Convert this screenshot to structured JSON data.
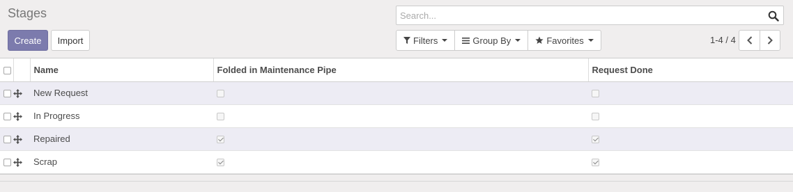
{
  "page": {
    "title": "Stages"
  },
  "buttons": {
    "create": "Create",
    "import": "Import"
  },
  "search": {
    "placeholder": "Search..."
  },
  "filters": {
    "filters": "Filters",
    "group_by": "Group By",
    "favorites": "Favorites"
  },
  "pager": {
    "value": "1-4 / 4"
  },
  "table": {
    "columns": [
      "Name",
      "Folded in Maintenance Pipe",
      "Request Done"
    ],
    "rows": [
      {
        "name": "New Request",
        "folded": false,
        "done": false
      },
      {
        "name": "In Progress",
        "folded": false,
        "done": false
      },
      {
        "name": "Repaired",
        "folded": true,
        "done": true
      },
      {
        "name": "Scrap",
        "folded": true,
        "done": true
      }
    ]
  },
  "colors": {
    "primary": "#7c7bad",
    "row_highlight": "#edecf4"
  }
}
